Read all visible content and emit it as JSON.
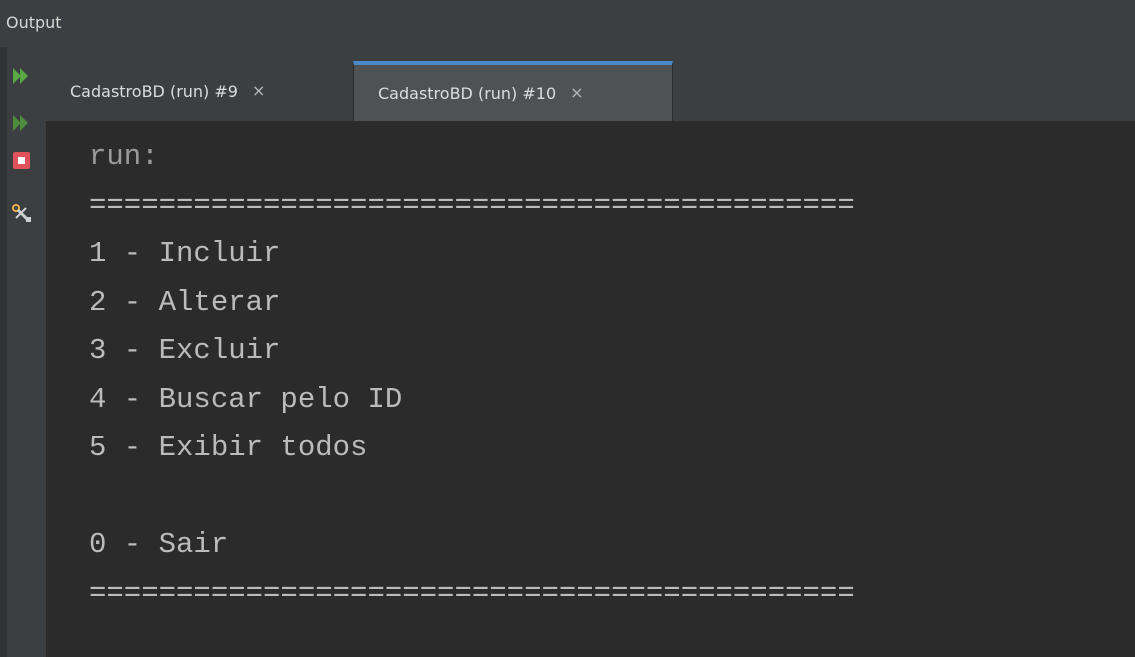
{
  "panel": {
    "title": "Output"
  },
  "tabs": [
    {
      "label": "CadastroBD (run) #9",
      "close": "×",
      "active": false
    },
    {
      "label": "CadastroBD (run) #10",
      "close": "×",
      "active": true
    }
  ],
  "toolbar": {
    "icons": [
      "rerun-icon",
      "rerun-failed-icon",
      "stop-icon",
      "settings-icon"
    ],
    "colors": {
      "run": "#5aa844",
      "stop": "#e0535b"
    }
  },
  "console": {
    "lines": [
      "run:",
      "============================================",
      "1 - Incluir",
      "2 - Alterar",
      "3 - Excluir",
      "4 - Buscar pelo ID",
      "5 - Exibir todos",
      "",
      "0 - Sair",
      "============================================"
    ]
  },
  "colors": {
    "accent": "#4a88c7",
    "console_bg": "#2b2b2b",
    "panel_bg": "#3c3f41",
    "text": "#bbbbbb"
  }
}
